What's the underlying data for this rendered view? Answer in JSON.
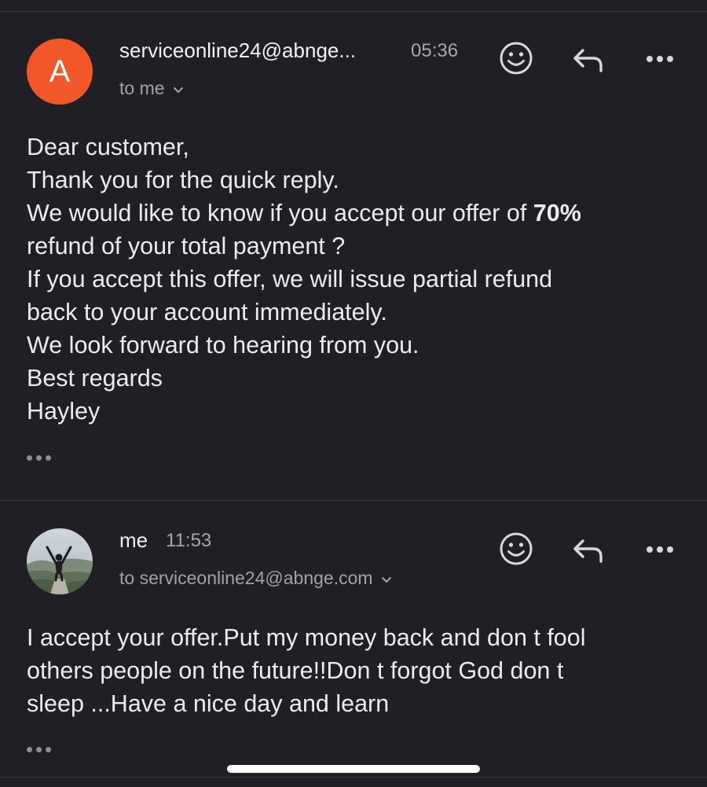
{
  "messages": [
    {
      "avatar_letter": "A",
      "avatar_color": "#f2572a",
      "sender": "serviceonline24@abnge...",
      "time": "05:36",
      "recipient": "to me",
      "body": {
        "line1": "Dear customer,",
        "line2": "Thank you for the quick reply.",
        "line3_pre": "We would like to know if you accept our offer of ",
        "line3_bold": "70%",
        "line4": "refund of your total payment ?",
        "line5": "If you accept this offer, we will issue partial refund",
        "line6": "back to your account immediately.",
        "line7": "We look forward to hearing from you.",
        "line8": "Best regards",
        "line9": "Hayley"
      },
      "icons": [
        "emoji-reaction-icon",
        "reply-icon",
        "more-options-icon"
      ]
    },
    {
      "avatar": "profile-photo",
      "sender": "me",
      "time": "11:53",
      "recipient": "to serviceonline24@abnge.com",
      "body": {
        "line1": "I accept your offer.Put my money back and don t fool",
        "line2": "others people on the future!!Don t forgot God don t",
        "line3": "sleep ...Have a nice day and learn"
      },
      "icons": [
        "emoji-reaction-icon",
        "reply-icon",
        "more-options-icon"
      ]
    }
  ],
  "theme": {
    "background": "#1f1f25",
    "text": "#ececef",
    "secondary_text": "#a6a6ad"
  }
}
